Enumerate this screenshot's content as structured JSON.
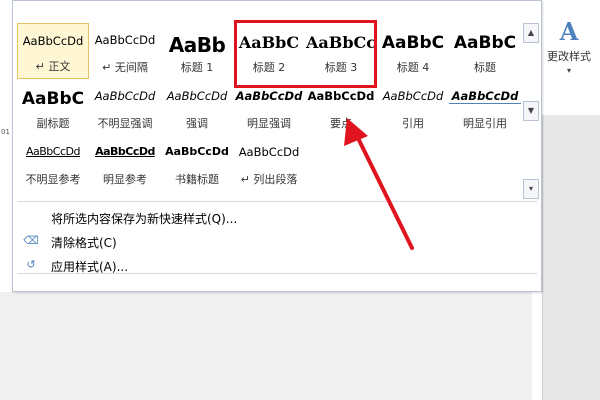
{
  "gallery": {
    "styles": [
      {
        "sample": "AaBbCcDd",
        "name": "↵ 正文",
        "cls": "s-body",
        "selected": true
      },
      {
        "sample": "AaBbCcDd",
        "name": "↵ 无间隔",
        "cls": "s-body"
      },
      {
        "sample": "AaBb",
        "name": "标题 1",
        "cls": "s-h1"
      },
      {
        "sample": "AaBbC",
        "name": "标题 2",
        "cls": "s-h2"
      },
      {
        "sample": "AaBbCc",
        "name": "标题 3",
        "cls": "s-h2"
      },
      {
        "sample": "AaBbC",
        "name": "标题 4",
        "cls": "s-big"
      },
      {
        "sample": "AaBbC",
        "name": "标题",
        "cls": "s-big"
      },
      {
        "sample": "AaBbC",
        "name": "副标题",
        "cls": "s-big"
      },
      {
        "sample": "AaBbCcDd",
        "name": "不明显强调",
        "cls": "s-subtle"
      },
      {
        "sample": "AaBbCcDd",
        "name": "强调",
        "cls": "s-em"
      },
      {
        "sample": "AaBbCcDd",
        "name": "明显强调",
        "cls": "s-intense"
      },
      {
        "sample": "AaBbCcDd",
        "name": "要点",
        "cls": "s-strong"
      },
      {
        "sample": "AaBbCcDd",
        "name": "引用",
        "cls": "s-quote"
      },
      {
        "sample": "AaBbCcDd",
        "name": "明显引用",
        "cls": "s-iquote"
      },
      {
        "sample": "AaBbCcDd",
        "name": "不明显参考",
        "cls": "s-sref"
      },
      {
        "sample": "AaBbCcDd",
        "name": "明显参考",
        "cls": "s-iref"
      },
      {
        "sample": "AaBbCcDd",
        "name": "书籍标题",
        "cls": "s-book"
      },
      {
        "sample": "AaBbCcDd",
        "name": "↵ 列出段落",
        "cls": "s-list"
      }
    ]
  },
  "menu": {
    "save_as_quick_style": "将所选内容保存为新快速样式(Q)...",
    "clear_formatting": "清除格式(C)",
    "apply_styles": "应用样式(A)..."
  },
  "ribbon": {
    "change_styles_label": "更改样式"
  },
  "icons": {
    "save": "save-quick-style-icon",
    "clear": "clear-formatting-icon",
    "apply": "apply-styles-icon",
    "change": "change-styles-icon"
  },
  "colors": {
    "highlight": "#e0141e",
    "accent": "#4f81bd",
    "reference": "#c0504d",
    "selected_bg": "#fff7d4"
  },
  "ruler_mark": "01"
}
